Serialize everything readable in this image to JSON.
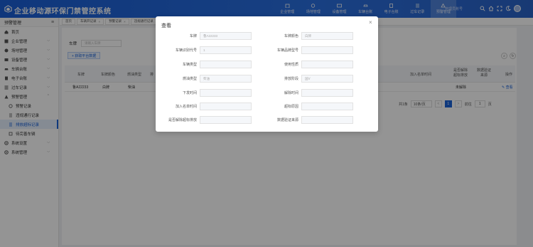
{
  "header": {
    "title": "企业移动源环保门禁管控系统",
    "nav": [
      {
        "label": "企业管理",
        "icon": "building-icon"
      },
      {
        "label": "场地管理",
        "icon": "location-icon"
      },
      {
        "label": "设备管理",
        "icon": "device-icon"
      },
      {
        "label": "车辆台账",
        "icon": "car-icon"
      },
      {
        "label": "电子台账",
        "icon": "ledger-icon"
      },
      {
        "label": "过车记录",
        "icon": "record-icon"
      },
      {
        "label": "预警管理",
        "icon": "alarm-icon"
      }
    ],
    "extra": "管理员账号"
  },
  "sidebar": {
    "header": "预警管理",
    "items": [
      {
        "label": "首页",
        "icon": "home-icon",
        "sub": false
      },
      {
        "label": "企业管理",
        "icon": "building-icon",
        "sub": false,
        "chev": "v"
      },
      {
        "label": "场地管理",
        "icon": "location-icon",
        "sub": false,
        "chev": "v"
      },
      {
        "label": "设备管理",
        "icon": "device-icon",
        "sub": false,
        "chev": "v"
      },
      {
        "label": "车辆台账",
        "icon": "car-icon",
        "sub": false,
        "chev": "v"
      },
      {
        "label": "电子台账",
        "icon": "ledger-icon",
        "sub": false,
        "chev": "v"
      },
      {
        "label": "过车记录",
        "icon": "record-icon",
        "sub": false,
        "chev": "v"
      },
      {
        "label": "预警管理",
        "icon": "alarm-icon",
        "sub": false,
        "chev": "^"
      },
      {
        "label": "预警记录",
        "icon": "list-icon",
        "sub": true
      },
      {
        "label": "违规通行记录",
        "icon": "list-icon",
        "sub": true
      },
      {
        "label": "排放超标记录",
        "icon": "list-icon",
        "sub": true,
        "active": true
      },
      {
        "label": "待完善车辆",
        "icon": "list-icon",
        "sub": true
      },
      {
        "label": "系统设置",
        "icon": "gear-icon",
        "sub": false,
        "chev": "v"
      },
      {
        "label": "系统管理",
        "icon": "gear-icon",
        "sub": false,
        "chev": "v"
      }
    ]
  },
  "tabs": [
    {
      "label": "首页"
    },
    {
      "label": "车辆开记录",
      "closable": true
    },
    {
      "label": "预警记录",
      "closable": true
    },
    {
      "label": "违规通行记录",
      "closable": true
    }
  ],
  "main": {
    "filter_label": "车牌",
    "filter_placeholder": "请输入车牌",
    "fetch_button": "+ 获取平台数据",
    "columns": [
      "车牌",
      "车牌颜色",
      "燃油类型",
      "排",
      "加入名单时间",
      "是否解除超标排放",
      "数据验证来源",
      "操作"
    ],
    "rows": [
      {
        "plate": "鲁A22233",
        "color": "白牌",
        "fuel": "柴油",
        "stage": "",
        "join_time": "",
        "released": "未解除",
        "source": "",
        "action": "查看"
      }
    ]
  },
  "pager": {
    "total": "共1条",
    "size": "10条/页",
    "prev": "<",
    "page": "1",
    "next": ">",
    "goto": "前往",
    "goto_val": "1",
    "unit": "页"
  },
  "dialog": {
    "title": "查看",
    "close": "×",
    "fields": [
      {
        "label": "车牌",
        "value": "鲁A22233"
      },
      {
        "label": "车牌颜色",
        "value": "白牌"
      },
      {
        "label": "车辆识别代号",
        "value": "1"
      },
      {
        "label": "车辆品牌型号",
        "value": ""
      },
      {
        "label": "车辆类型",
        "value": ""
      },
      {
        "label": "使用性质",
        "value": ""
      },
      {
        "label": "燃油类型",
        "value": "柴油"
      },
      {
        "label": "排放阶段",
        "value": "国Ⅴ"
      },
      {
        "label": "下发时间",
        "value": ""
      },
      {
        "label": "解除时间",
        "value": ""
      },
      {
        "label": "加入名单时间",
        "value": ""
      },
      {
        "label": "超标原因",
        "value": ""
      },
      {
        "label": "是否解除超标排放",
        "value": ""
      },
      {
        "label": "数据验证来源",
        "value": ""
      }
    ]
  }
}
